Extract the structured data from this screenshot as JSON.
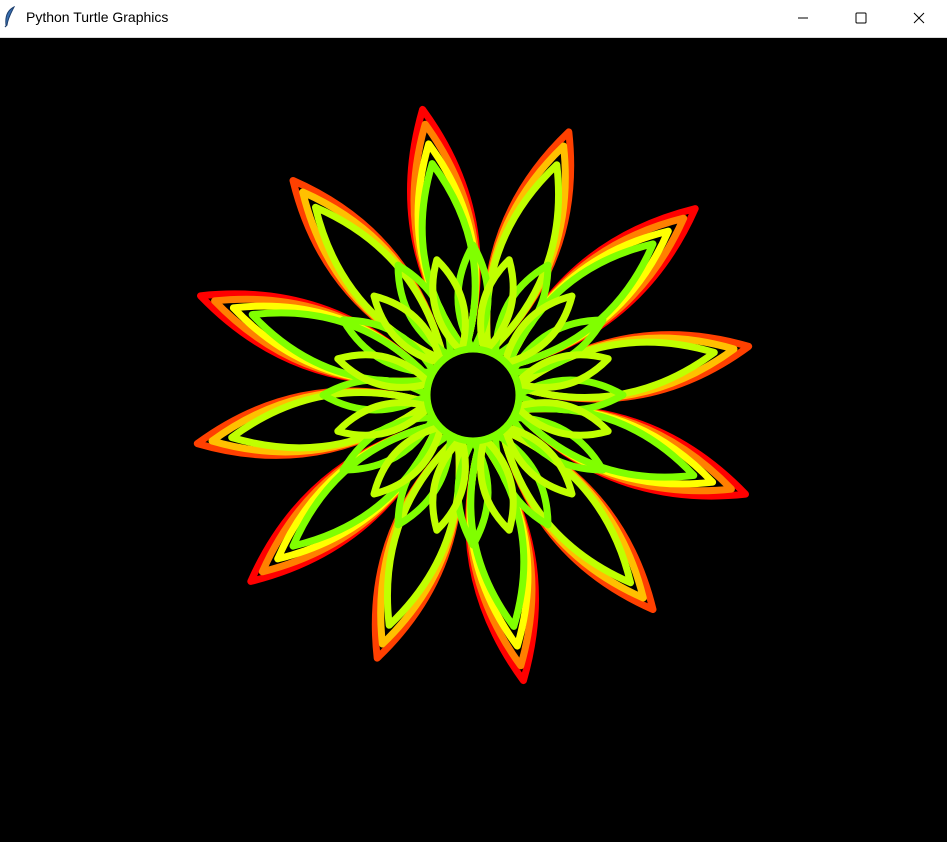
{
  "window": {
    "title": "Python Turtle Graphics",
    "app_icon": "feather-icon",
    "controls": [
      "minimize-icon",
      "maximize-icon",
      "close-icon"
    ]
  },
  "canvas": {
    "background": "#000000",
    "drawing": "flower-of-petal-loops",
    "center_hole_color": "#000000",
    "petal_colors": [
      "#ff0000",
      "#ff4000",
      "#ff8000",
      "#ffc000",
      "#ffff00",
      "#c0ff00",
      "#80ff00"
    ]
  }
}
